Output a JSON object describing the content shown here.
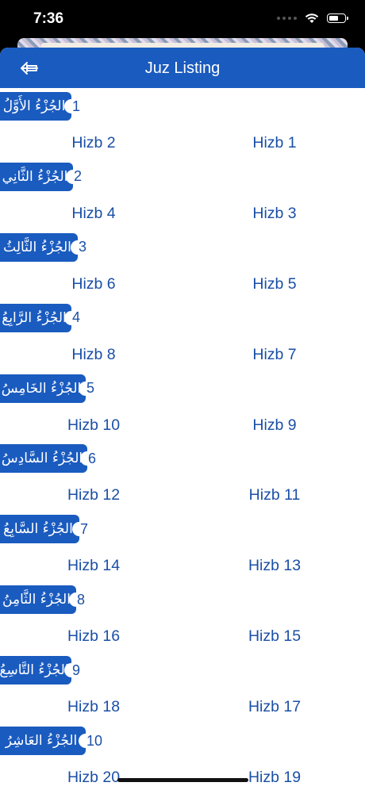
{
  "status_bar": {
    "time": "7:36"
  },
  "nav": {
    "title": "Juz Listing"
  },
  "juz_list": [
    {
      "arabic": "الجُزْءُ الأَوَّلُ",
      "number": "1",
      "hizb_left": "Hizb 2",
      "hizb_right": "Hizb 1"
    },
    {
      "arabic": "الجُزْءُ الثَّانِي",
      "number": "2",
      "hizb_left": "Hizb 4",
      "hizb_right": "Hizb 3"
    },
    {
      "arabic": "الجُزْءُ الثَّالِثُ",
      "number": "3",
      "hizb_left": "Hizb 6",
      "hizb_right": "Hizb 5"
    },
    {
      "arabic": "الجُزْءُ الرَّابِعُ",
      "number": "4",
      "hizb_left": "Hizb 8",
      "hizb_right": "Hizb 7"
    },
    {
      "arabic": "الجُزْءُ الخَامِسُ",
      "number": "5",
      "hizb_left": "Hizb 10",
      "hizb_right": "Hizb 9"
    },
    {
      "arabic": "الجُزْءُ السَّادِسُ",
      "number": "6",
      "hizb_left": "Hizb 12",
      "hizb_right": "Hizb 11"
    },
    {
      "arabic": "الجُزْءُ السَّابِعُ",
      "number": "7",
      "hizb_left": "Hizb 14",
      "hizb_right": "Hizb 13"
    },
    {
      "arabic": "الجُزْءُ الثَّامِنُ",
      "number": "8",
      "hizb_left": "Hizb 16",
      "hizb_right": "Hizb 15"
    },
    {
      "arabic": "الجُزْءُ التَّاسِعُ",
      "number": "9",
      "hizb_left": "Hizb 18",
      "hizb_right": "Hizb 17"
    },
    {
      "arabic": "الجُزْءُ العَاشِرُ",
      "number": "10",
      "hizb_left": "Hizb 20",
      "hizb_right": "Hizb 19"
    }
  ],
  "colors": {
    "primary": "#1a5bbf",
    "text": "#1a4fa6",
    "background": "#ffffff"
  },
  "icons": {
    "back": "back-arrow-icon",
    "wifi": "wifi-icon",
    "battery": "battery-icon"
  }
}
